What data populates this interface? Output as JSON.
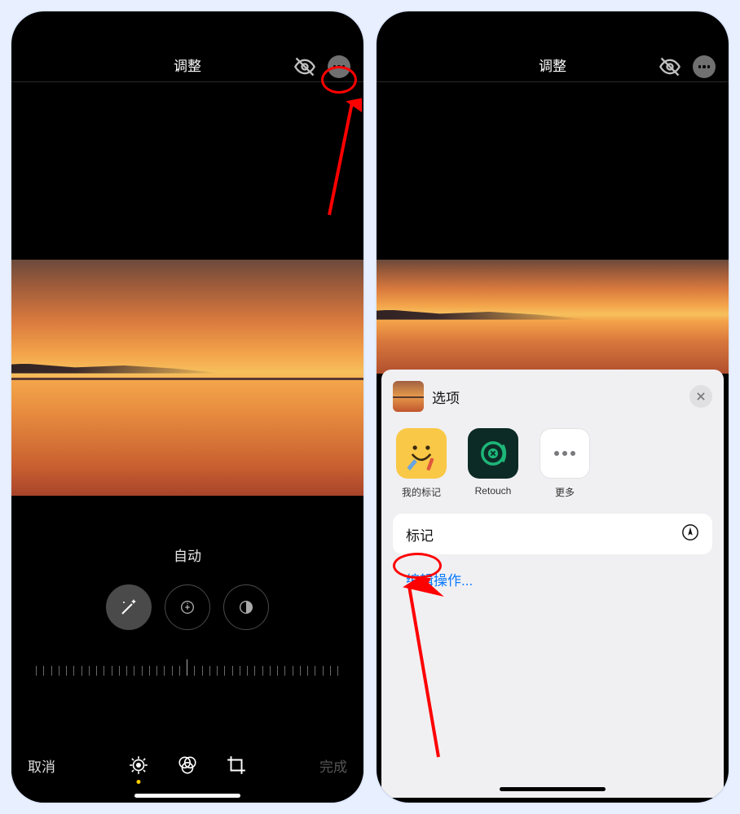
{
  "left": {
    "title": "调整",
    "auto_label": "自动",
    "cancel": "取消",
    "done": "完成"
  },
  "right": {
    "title": "调整",
    "sheet": {
      "title": "选项",
      "apps": [
        {
          "label": "我的标记"
        },
        {
          "label": "Retouch"
        },
        {
          "label": "更多"
        }
      ],
      "markup": "标记",
      "edit_ops": "编辑操作..."
    }
  }
}
